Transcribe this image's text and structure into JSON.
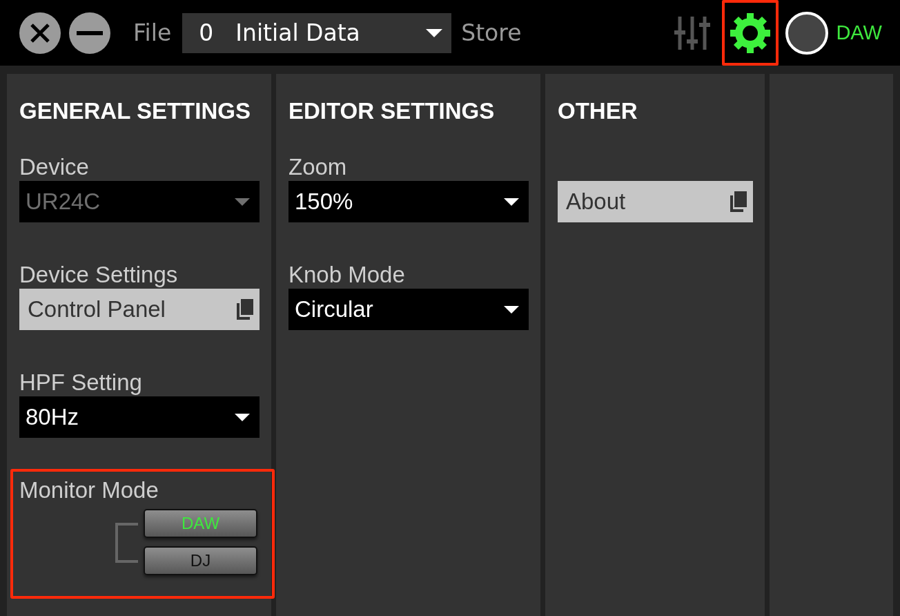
{
  "toolbar": {
    "file_label": "File",
    "scene_select": {
      "number": "0",
      "name": "Initial Data"
    },
    "store_label": "Store",
    "views": [
      {
        "kind": "mixer",
        "selected": false,
        "highlighted": false
      },
      {
        "kind": "settings",
        "selected": true,
        "highlighted": true
      }
    ],
    "mode_indicator": "DAW"
  },
  "columns": [
    {
      "title": "GENERAL SETTINGS",
      "settings": [
        {
          "kind": "select",
          "label": "Device",
          "value": "UR24C",
          "disabled": true
        },
        {
          "kind": "button",
          "label": "Device Settings",
          "value": "Control Panel"
        },
        {
          "kind": "select",
          "label": "HPF Setting",
          "value": "80Hz",
          "disabled": false
        },
        {
          "kind": "radio",
          "label": "Monitor Mode",
          "highlighted": true,
          "options": [
            {
              "label": "DAW",
              "selected": true
            },
            {
              "label": "DJ",
              "selected": false
            }
          ]
        }
      ]
    },
    {
      "title": "EDITOR SETTINGS",
      "settings": [
        {
          "kind": "select",
          "label": "Zoom",
          "value": "150%",
          "disabled": false
        },
        {
          "kind": "select",
          "label": "Knob Mode",
          "value": "Circular",
          "disabled": false
        }
      ]
    },
    {
      "title": "OTHER",
      "settings": [
        {
          "kind": "button",
          "value": "About"
        }
      ]
    }
  ]
}
